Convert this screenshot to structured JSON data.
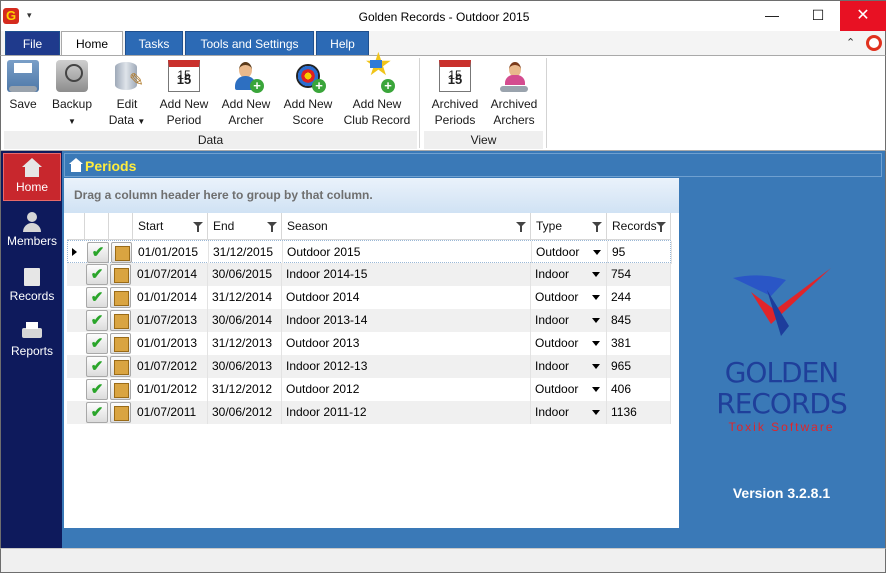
{
  "window": {
    "title": "Golden Records - Outdoor 2015",
    "app_icon_letter": "G"
  },
  "ribbon_tabs": [
    "File",
    "Home",
    "Tasks",
    "Tools and Settings",
    "Help"
  ],
  "ribbon": {
    "save": "Save",
    "backup": "Backup",
    "edit_data_1": "Edit",
    "edit_data_2": "Data",
    "add_period_1": "Add New",
    "add_period_2": "Period",
    "add_archer_1": "Add New",
    "add_archer_2": "Archer",
    "add_score_1": "Add New",
    "add_score_2": "Score",
    "add_club_record_1": "Add New",
    "add_club_record_2": "Club Record",
    "archived_periods_1": "Archived",
    "archived_periods_2": "Periods",
    "archived_archers_1": "Archived",
    "archived_archers_2": "Archers",
    "group_data": "Data",
    "group_view": "View",
    "calendar_day": "15"
  },
  "sidebar": [
    "Home",
    "Members",
    "Records",
    "Reports"
  ],
  "periods": {
    "title": "Periods",
    "group_hint": "Drag a column header here to group by that column.",
    "columns": [
      "Start",
      "End",
      "Season",
      "Type",
      "Records"
    ],
    "rows": [
      [
        "01/01/2015",
        "31/12/2015",
        "Outdoor 2015",
        "Outdoor",
        "95"
      ],
      [
        "01/07/2014",
        "30/06/2015",
        "Indoor 2014-15",
        "Indoor",
        "754"
      ],
      [
        "01/01/2014",
        "31/12/2014",
        "Outdoor 2014",
        "Outdoor",
        "244"
      ],
      [
        "01/07/2013",
        "30/06/2014",
        "Indoor 2013-14",
        "Indoor",
        "845"
      ],
      [
        "01/01/2013",
        "31/12/2013",
        "Outdoor 2013",
        "Outdoor",
        "381"
      ],
      [
        "01/07/2012",
        "30/06/2013",
        "Indoor 2012-13",
        "Indoor",
        "965"
      ],
      [
        "01/01/2012",
        "31/12/2012",
        "Outdoor 2012",
        "Outdoor",
        "406"
      ],
      [
        "01/07/2011",
        "30/06/2012",
        "Indoor 2011-12",
        "Indoor",
        "1136"
      ]
    ]
  },
  "branding": {
    "line1": "GOLDEN",
    "line2": "RECORDS",
    "sub": "Toxik Software",
    "version": "Version 3.2.8.1"
  },
  "colors": {
    "accent_blue": "#3a79b7",
    "sidebar_navy": "#0e1a5c",
    "active_red": "#c8272d",
    "title_yellow": "#ffec3d"
  }
}
